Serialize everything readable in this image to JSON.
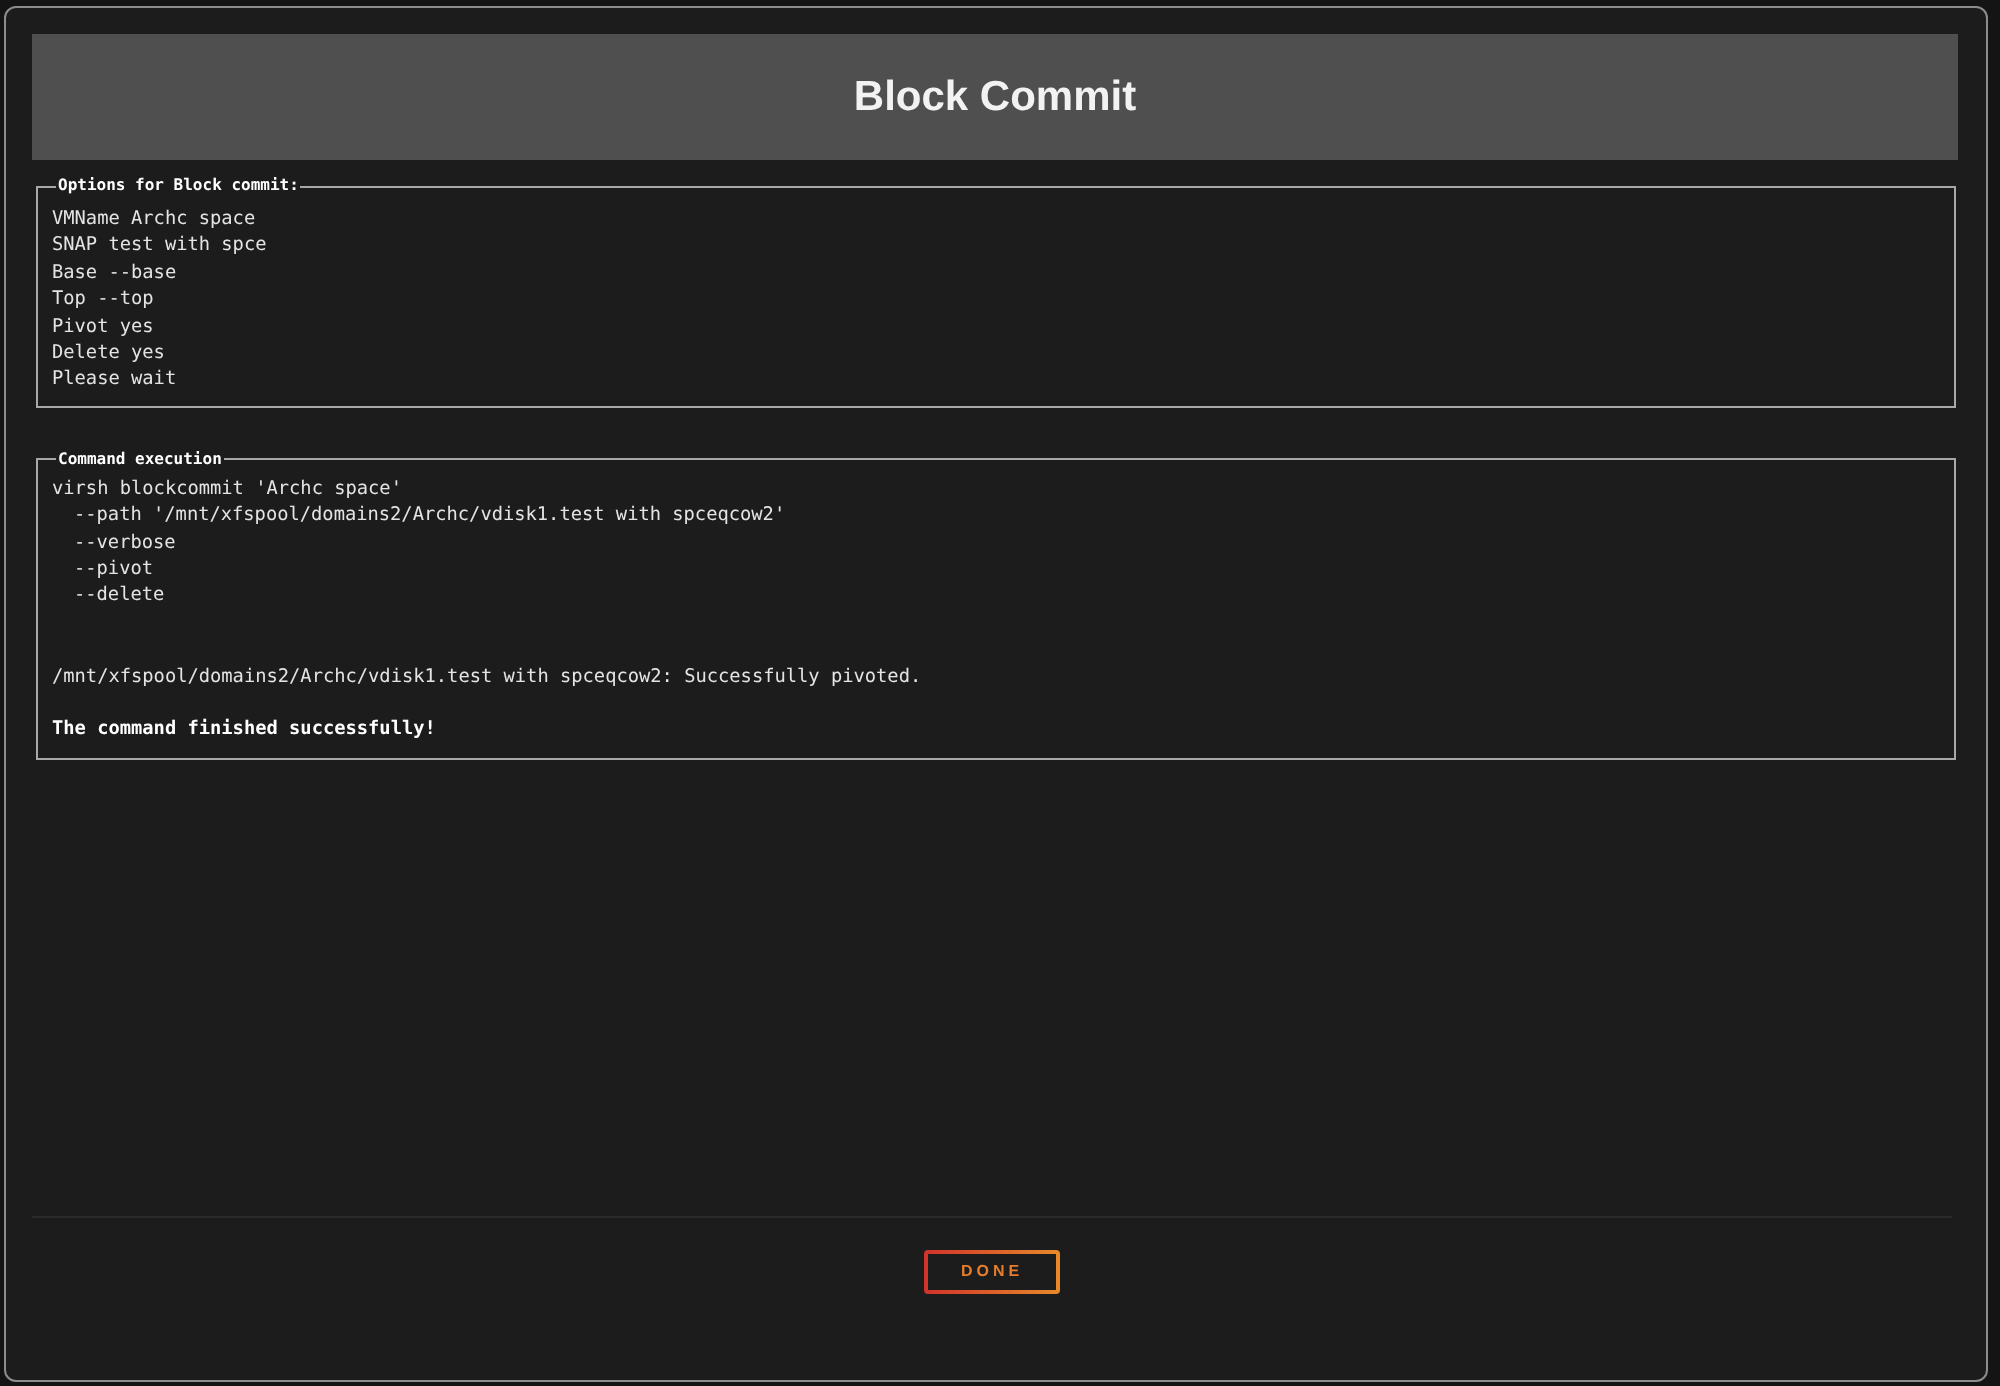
{
  "dialog": {
    "title": "Block Commit"
  },
  "options_section": {
    "legend": "Options for Block commit:",
    "lines": [
      "VMName Archc space",
      "SNAP test with spce",
      "Base --base",
      "Top --top",
      "Pivot yes",
      "Delete yes",
      "Please wait"
    ]
  },
  "command_section": {
    "legend": "Command execution",
    "command": "virsh blockcommit 'Archc space'",
    "arguments": [
      "--path '/mnt/xfspool/domains2/Archc/vdisk1.test with spceqcow2'",
      "--verbose",
      "--pivot",
      "--delete"
    ],
    "output": "/mnt/xfspool/domains2/Archc/vdisk1.test with spceqcow2: Successfully pivoted.",
    "result": "The command finished successfully!"
  },
  "buttons": [
    {
      "label": "DONE"
    }
  ]
}
